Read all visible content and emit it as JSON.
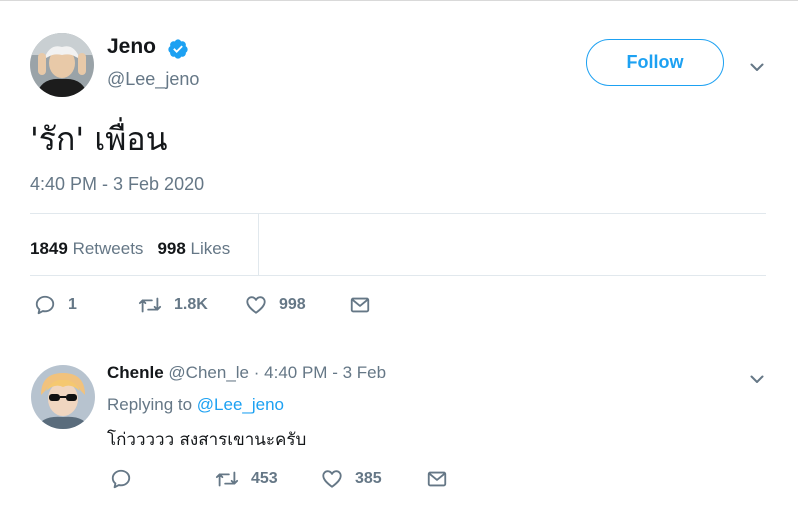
{
  "tweet": {
    "author": {
      "display_name": "Jeno",
      "handle": "@Lee_jeno",
      "verified": true
    },
    "follow_label": "Follow",
    "text": "'รัก' เพื่อน",
    "timestamp": "4:40 PM - 3 Feb 2020",
    "stats": {
      "retweets_count": "1849",
      "retweets_label": "Retweets",
      "likes_count": "998",
      "likes_label": "Likes"
    },
    "actions": {
      "replies": "1",
      "retweets": "1.8K",
      "likes": "998"
    }
  },
  "reply": {
    "author": {
      "display_name": "Chenle",
      "handle": "@Chen_le"
    },
    "separator": "·",
    "time": "4:40 PM - 3 Feb",
    "replying_to_label": "Replying to",
    "replying_to_handle": "@Lee_jeno",
    "text": "โก่ววววว สงสารเขานะครับ",
    "actions": {
      "replies": "",
      "retweets": "453",
      "likes": "385"
    }
  },
  "colors": {
    "accent": "#1da1f2",
    "secondary_text": "#657786",
    "primary_text": "#14171a",
    "divider": "#e1e8ed"
  },
  "icons": [
    "verified-badge-icon",
    "chevron-down-icon",
    "reply-icon",
    "retweet-icon",
    "heart-icon",
    "message-icon"
  ]
}
